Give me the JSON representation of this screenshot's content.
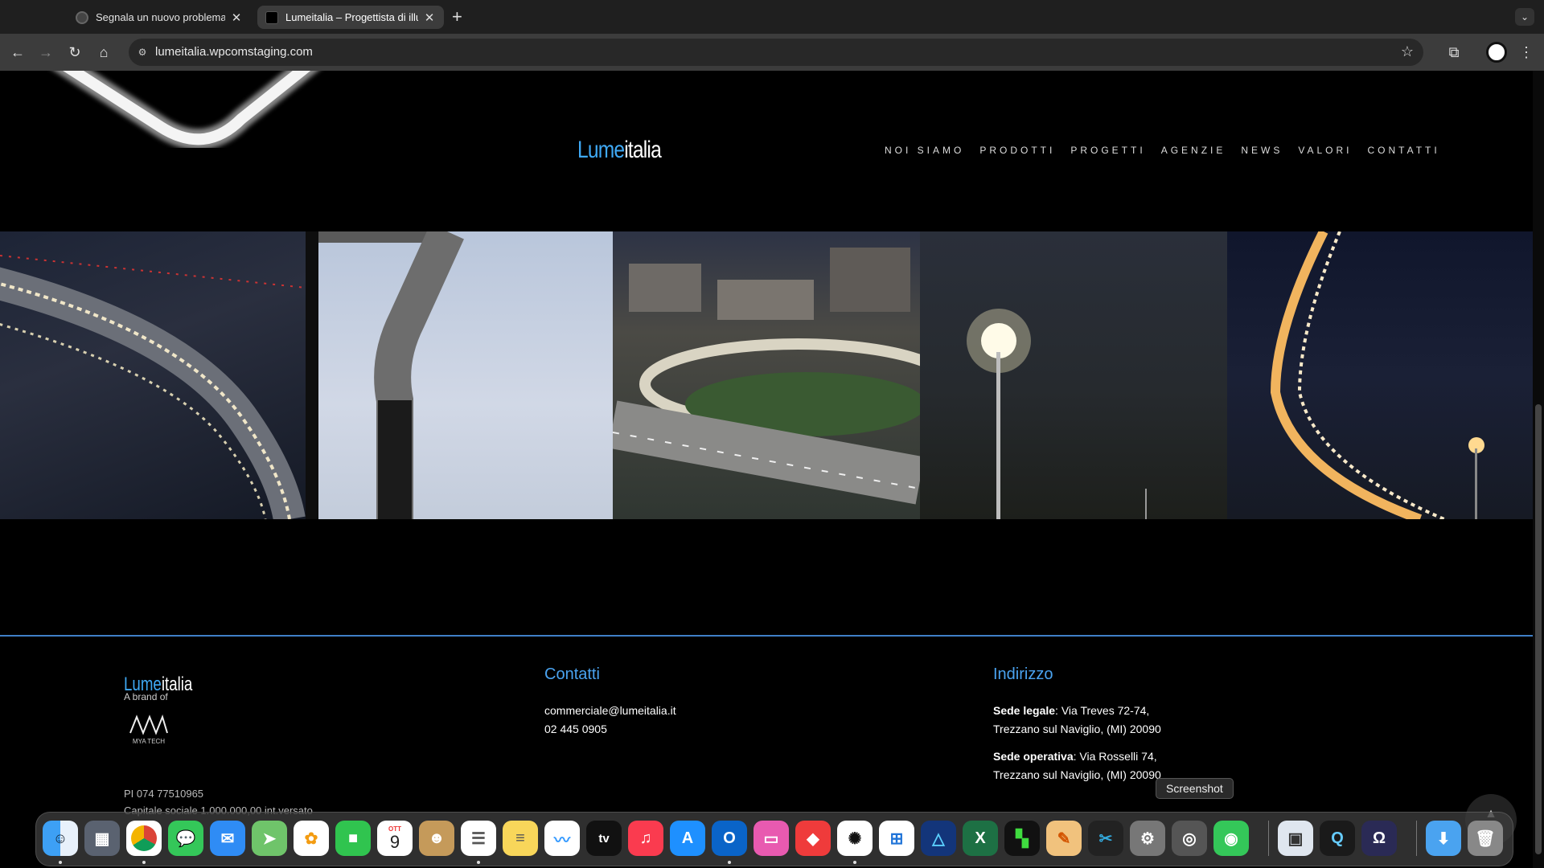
{
  "browser": {
    "tabs": [
      {
        "title": "Segnala un nuovo problema -",
        "active": false
      },
      {
        "title": "Lumeitalia – Progettista di illu",
        "active": true
      }
    ],
    "url": "lumeitalia.wpcomstaging.com"
  },
  "site": {
    "logo": {
      "part1": "Lume",
      "part2": "italia"
    },
    "nav": [
      "NOI SIAMO",
      "PRODOTTI",
      "PROGETTI",
      "AGENZIE",
      "NEWS",
      "VALORI",
      "CONTATTI"
    ]
  },
  "footer": {
    "logo": {
      "part1": "Lume",
      "part2": "italia"
    },
    "brand_of": "A brand of",
    "mya_label": "MYA TECH",
    "pi": "PI 074 77510965",
    "capital": "Capitale sociale 1.000.000,00 int.versato",
    "contatti": {
      "heading": "Contatti",
      "email": "commerciale@lumeitalia.it",
      "phone": "02 445 0905"
    },
    "indirizzo": {
      "heading": "Indirizzo",
      "legale_label": "Sede legale",
      "legale_line1": ": Via Treves 72-74,",
      "legale_line2": "Trezzano sul Naviglio, (MI) 20090",
      "operativa_label": "Sede operativa",
      "operativa_line1": ": Via Rosselli 74,",
      "operativa_line2": "Trezzano sul Naviglio, (MI) 20090"
    }
  },
  "tooltip": "Screenshot",
  "dock": {
    "icons": [
      "finder-icon",
      "launchpad-icon",
      "chrome-icon",
      "messages-icon",
      "mail-icon",
      "maps-icon",
      "photos-icon",
      "facetime-icon",
      "calendar-icon",
      "contacts-icon",
      "reminders-icon",
      "notes-icon",
      "freeform-icon",
      "tv-icon",
      "music-icon",
      "app-store-icon",
      "outlook-icon",
      "keynote-icon",
      "anydesk-icon",
      "chatgpt-icon",
      "windows-app-icon",
      "affinity-designer-icon",
      "excel-icon",
      "mtr-icon",
      "pixelmator-icon",
      "final-cut-icon",
      "system-settings-icon",
      "screenshot-icon",
      "find-my-icon",
      "preview-icon",
      "quicktime-icon",
      "dictionary-icon",
      "downloads-icon",
      "trash-icon"
    ],
    "calendar_month": "OTT",
    "calendar_day": "9",
    "tv_label": "tv"
  }
}
